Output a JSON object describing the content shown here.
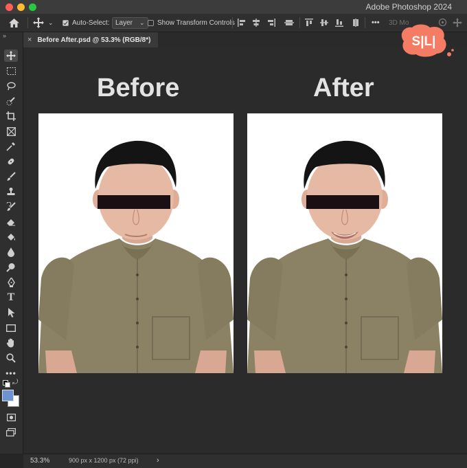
{
  "app": {
    "title": "Adobe Photoshop 2024"
  },
  "options_bar": {
    "auto_select_label": "Auto-Select:",
    "auto_select_value": "Layer",
    "show_transform_label": "Show Transform Controls",
    "mode_3d_label": "3D Mo",
    "more_label": "•••"
  },
  "document": {
    "tab_label": "Before After.psd @ 53.3% (RGB/8*)",
    "close_glyph": "×"
  },
  "canvas": {
    "before_title": "Before",
    "after_title": "After"
  },
  "status": {
    "zoom": "53.3%",
    "doc_info": "900 px x 1200 px (72 ppi)",
    "arrow": "›"
  },
  "watermark": {
    "text": "S|L|"
  },
  "colors": {
    "foreground": "#6d93d1",
    "background": "#ffffff",
    "shirt": "#8b8164",
    "skin": "#e5b9a4",
    "hair": "#141414",
    "censor_bar": "#1b0f14"
  },
  "tools": [
    "move-tool-icon",
    "marquee-tool-icon",
    "lasso-tool-icon",
    "quick-select-tool-icon",
    "crop-tool-icon",
    "frame-tool-icon",
    "eyedropper-tool-icon",
    "healing-brush-tool-icon",
    "brush-tool-icon",
    "clone-stamp-tool-icon",
    "history-brush-tool-icon",
    "eraser-tool-icon",
    "paint-bucket-tool-icon",
    "blur-tool-icon",
    "dodge-tool-icon",
    "pen-tool-icon",
    "type-tool-icon",
    "path-select-tool-icon",
    "rectangle-tool-icon",
    "hand-tool-icon",
    "zoom-tool-icon",
    "more-tools-icon"
  ]
}
